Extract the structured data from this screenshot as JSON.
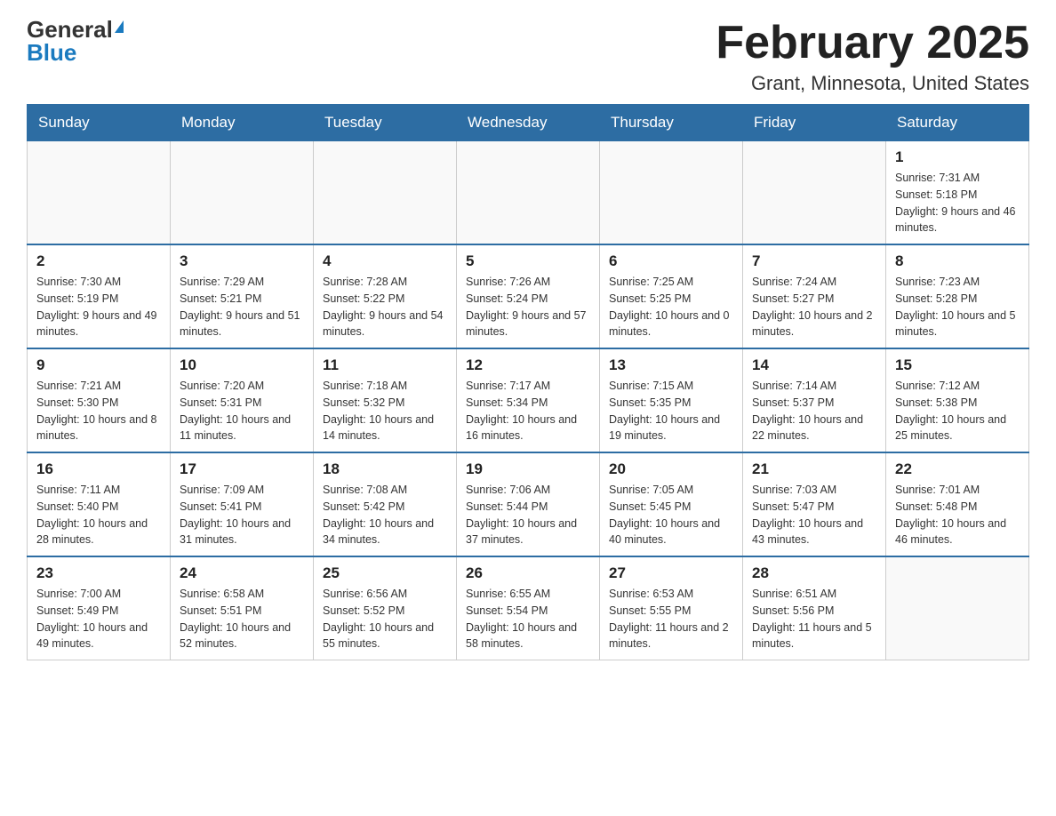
{
  "header": {
    "logo_general": "General",
    "logo_blue": "Blue",
    "title": "February 2025",
    "subtitle": "Grant, Minnesota, United States"
  },
  "days_of_week": [
    "Sunday",
    "Monday",
    "Tuesday",
    "Wednesday",
    "Thursday",
    "Friday",
    "Saturday"
  ],
  "weeks": [
    [
      {
        "day": "",
        "info": ""
      },
      {
        "day": "",
        "info": ""
      },
      {
        "day": "",
        "info": ""
      },
      {
        "day": "",
        "info": ""
      },
      {
        "day": "",
        "info": ""
      },
      {
        "day": "",
        "info": ""
      },
      {
        "day": "1",
        "info": "Sunrise: 7:31 AM\nSunset: 5:18 PM\nDaylight: 9 hours and 46 minutes."
      }
    ],
    [
      {
        "day": "2",
        "info": "Sunrise: 7:30 AM\nSunset: 5:19 PM\nDaylight: 9 hours and 49 minutes."
      },
      {
        "day": "3",
        "info": "Sunrise: 7:29 AM\nSunset: 5:21 PM\nDaylight: 9 hours and 51 minutes."
      },
      {
        "day": "4",
        "info": "Sunrise: 7:28 AM\nSunset: 5:22 PM\nDaylight: 9 hours and 54 minutes."
      },
      {
        "day": "5",
        "info": "Sunrise: 7:26 AM\nSunset: 5:24 PM\nDaylight: 9 hours and 57 minutes."
      },
      {
        "day": "6",
        "info": "Sunrise: 7:25 AM\nSunset: 5:25 PM\nDaylight: 10 hours and 0 minutes."
      },
      {
        "day": "7",
        "info": "Sunrise: 7:24 AM\nSunset: 5:27 PM\nDaylight: 10 hours and 2 minutes."
      },
      {
        "day": "8",
        "info": "Sunrise: 7:23 AM\nSunset: 5:28 PM\nDaylight: 10 hours and 5 minutes."
      }
    ],
    [
      {
        "day": "9",
        "info": "Sunrise: 7:21 AM\nSunset: 5:30 PM\nDaylight: 10 hours and 8 minutes."
      },
      {
        "day": "10",
        "info": "Sunrise: 7:20 AM\nSunset: 5:31 PM\nDaylight: 10 hours and 11 minutes."
      },
      {
        "day": "11",
        "info": "Sunrise: 7:18 AM\nSunset: 5:32 PM\nDaylight: 10 hours and 14 minutes."
      },
      {
        "day": "12",
        "info": "Sunrise: 7:17 AM\nSunset: 5:34 PM\nDaylight: 10 hours and 16 minutes."
      },
      {
        "day": "13",
        "info": "Sunrise: 7:15 AM\nSunset: 5:35 PM\nDaylight: 10 hours and 19 minutes."
      },
      {
        "day": "14",
        "info": "Sunrise: 7:14 AM\nSunset: 5:37 PM\nDaylight: 10 hours and 22 minutes."
      },
      {
        "day": "15",
        "info": "Sunrise: 7:12 AM\nSunset: 5:38 PM\nDaylight: 10 hours and 25 minutes."
      }
    ],
    [
      {
        "day": "16",
        "info": "Sunrise: 7:11 AM\nSunset: 5:40 PM\nDaylight: 10 hours and 28 minutes."
      },
      {
        "day": "17",
        "info": "Sunrise: 7:09 AM\nSunset: 5:41 PM\nDaylight: 10 hours and 31 minutes."
      },
      {
        "day": "18",
        "info": "Sunrise: 7:08 AM\nSunset: 5:42 PM\nDaylight: 10 hours and 34 minutes."
      },
      {
        "day": "19",
        "info": "Sunrise: 7:06 AM\nSunset: 5:44 PM\nDaylight: 10 hours and 37 minutes."
      },
      {
        "day": "20",
        "info": "Sunrise: 7:05 AM\nSunset: 5:45 PM\nDaylight: 10 hours and 40 minutes."
      },
      {
        "day": "21",
        "info": "Sunrise: 7:03 AM\nSunset: 5:47 PM\nDaylight: 10 hours and 43 minutes."
      },
      {
        "day": "22",
        "info": "Sunrise: 7:01 AM\nSunset: 5:48 PM\nDaylight: 10 hours and 46 minutes."
      }
    ],
    [
      {
        "day": "23",
        "info": "Sunrise: 7:00 AM\nSunset: 5:49 PM\nDaylight: 10 hours and 49 minutes."
      },
      {
        "day": "24",
        "info": "Sunrise: 6:58 AM\nSunset: 5:51 PM\nDaylight: 10 hours and 52 minutes."
      },
      {
        "day": "25",
        "info": "Sunrise: 6:56 AM\nSunset: 5:52 PM\nDaylight: 10 hours and 55 minutes."
      },
      {
        "day": "26",
        "info": "Sunrise: 6:55 AM\nSunset: 5:54 PM\nDaylight: 10 hours and 58 minutes."
      },
      {
        "day": "27",
        "info": "Sunrise: 6:53 AM\nSunset: 5:55 PM\nDaylight: 11 hours and 2 minutes."
      },
      {
        "day": "28",
        "info": "Sunrise: 6:51 AM\nSunset: 5:56 PM\nDaylight: 11 hours and 5 minutes."
      },
      {
        "day": "",
        "info": ""
      }
    ]
  ]
}
